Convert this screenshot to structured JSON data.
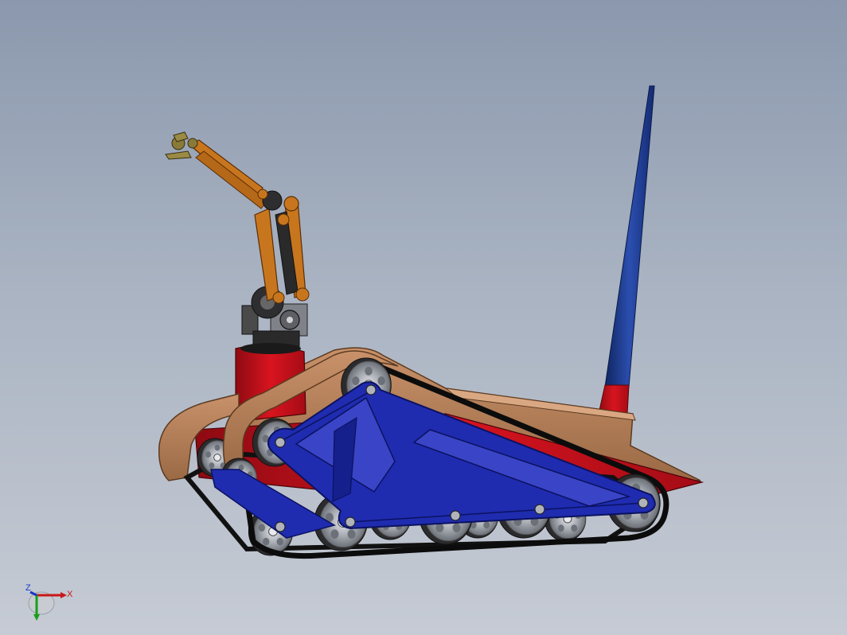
{
  "viewport": {
    "background_top": "#8b98ad",
    "background_bottom": "#c6cbd4"
  },
  "model": {
    "colors": {
      "track_frame": "#1f2cb0",
      "track_frame_edge": "#0b1260",
      "body_red": "#c8101c",
      "deck_wood": "#b07c55",
      "deck_wood_dark": "#8a5a37",
      "wheel": "#9a9ea6",
      "wheel_hub": "#d4d7dc",
      "track_belt": "#111111",
      "arm_orange": "#c8761e",
      "arm_dark": "#3a3a3a",
      "antenna_blue": "#1c3a8e",
      "antenna_red": "#c8101c"
    },
    "icons": [
      "coordinate-triad-icon"
    ]
  },
  "triad": {
    "x_label": "X",
    "y_label": "Y",
    "z_label": "Z",
    "x_color": "#c81818",
    "y_color": "#18a018",
    "z_color": "#1838c8"
  }
}
